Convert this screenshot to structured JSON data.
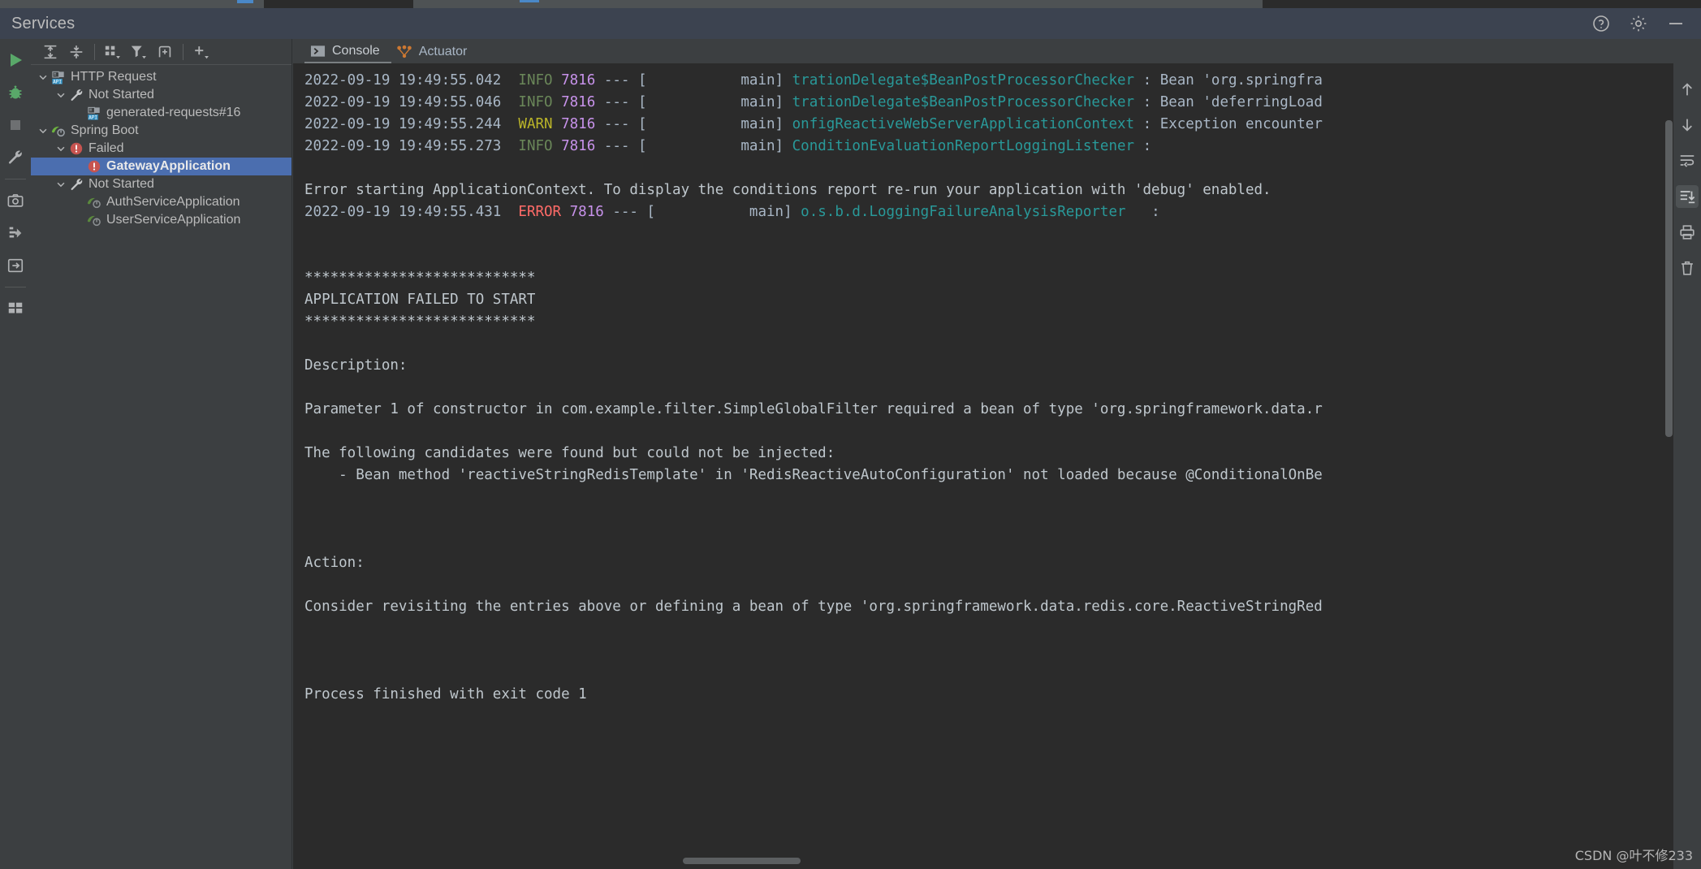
{
  "window": {
    "title": "Services",
    "actions": [
      {
        "name": "help-icon",
        "label": "?"
      },
      {
        "name": "settings-gear-icon",
        "label": "Settings"
      },
      {
        "name": "minimize-icon",
        "label": "Minimize"
      }
    ]
  },
  "left_strip": {
    "items": [
      {
        "name": "run-icon",
        "label": "Run"
      },
      {
        "name": "debug-icon",
        "label": "Debug"
      },
      {
        "name": "stop-icon",
        "label": "Stop"
      },
      {
        "name": "settings-wrench-icon",
        "label": "Configure"
      },
      {
        "name": "camera-icon",
        "label": "Snapshot"
      },
      {
        "name": "profiler-icon",
        "label": "Profiler"
      },
      {
        "name": "open-in-icon",
        "label": "Open"
      },
      {
        "name": "dashboard-icon",
        "label": "Dashboard"
      }
    ]
  },
  "tree_toolbar": {
    "items": [
      {
        "name": "expand-all-icon",
        "label": "Expand All"
      },
      {
        "name": "collapse-all-icon",
        "label": "Collapse All"
      },
      {
        "name": "group-by-icon",
        "label": "Group By"
      },
      {
        "name": "filter-icon",
        "label": "Filter"
      },
      {
        "name": "add-tab-icon",
        "label": "Add Tab"
      },
      {
        "name": "add-service-icon",
        "label": "Add Service"
      }
    ]
  },
  "tree": {
    "nodes": [
      {
        "label": "HTTP Request",
        "indent": 0,
        "icon": "api-icon",
        "expanded": true,
        "selected": false
      },
      {
        "label": "Not Started",
        "indent": 1,
        "icon": "wrench-icon",
        "expanded": true,
        "selected": false
      },
      {
        "label": "generated-requests#16",
        "indent": 2,
        "icon": "api-icon",
        "expanded": null,
        "selected": false
      },
      {
        "label": "Spring Boot",
        "indent": 0,
        "icon": "spring-icon",
        "expanded": true,
        "selected": false
      },
      {
        "label": "Failed",
        "indent": 1,
        "icon": "error-icon",
        "expanded": true,
        "selected": false
      },
      {
        "label": "GatewayApplication",
        "indent": 2,
        "icon": "error-icon",
        "expanded": null,
        "selected": true
      },
      {
        "label": "Not Started",
        "indent": 1,
        "icon": "wrench-icon",
        "expanded": true,
        "selected": false
      },
      {
        "label": "AuthServiceApplication",
        "indent": 2,
        "icon": "spring-gray-icon",
        "expanded": null,
        "selected": false
      },
      {
        "label": "UserServiceApplication",
        "indent": 2,
        "icon": "spring-gray-icon",
        "expanded": null,
        "selected": false
      }
    ]
  },
  "tabs": [
    {
      "name": "tab-console",
      "label": "Console",
      "icon": "console-icon",
      "active": true
    },
    {
      "name": "tab-actuator",
      "label": "Actuator",
      "icon": "actuator-icon",
      "active": false
    }
  ],
  "console": {
    "lines": [
      {
        "type": "log",
        "ts": "2022-09-19 19:49:55.042",
        "level": "INFO",
        "pid": "7816",
        "dash": "---",
        "thread": "[           main]",
        "logger": "trationDelegate$BeanPostProcessorChecker",
        "sep": " : ",
        "msg": "Bean 'org.springfra"
      },
      {
        "type": "log",
        "ts": "2022-09-19 19:49:55.046",
        "level": "INFO",
        "pid": "7816",
        "dash": "---",
        "thread": "[           main]",
        "logger": "trationDelegate$BeanPostProcessorChecker",
        "sep": " : ",
        "msg": "Bean 'deferringLoad"
      },
      {
        "type": "log",
        "ts": "2022-09-19 19:49:55.244",
        "level": "WARN",
        "pid": "7816",
        "dash": "---",
        "thread": "[           main]",
        "logger": "onfigReactiveWebServerApplicationContext",
        "sep": " : ",
        "msg": "Exception encounter"
      },
      {
        "type": "log",
        "ts": "2022-09-19 19:49:55.273",
        "level": "INFO",
        "pid": "7816",
        "dash": "---",
        "thread": "[           main]",
        "logger": "ConditionEvaluationReportLoggingListener",
        "sep": " : ",
        "msg": ""
      },
      {
        "type": "blank"
      },
      {
        "type": "plain",
        "text": "Error starting ApplicationContext. To display the conditions report re-run your application with 'debug' enabled."
      },
      {
        "type": "log",
        "ts": "2022-09-19 19:49:55.431",
        "level": "ERROR",
        "pid": "7816",
        "dash": "---",
        "thread": "[           main]",
        "logger": "o.s.b.d.LoggingFailureAnalysisReporter",
        "sep": "   : ",
        "msg": ""
      },
      {
        "type": "blank"
      },
      {
        "type": "blank"
      },
      {
        "type": "plain",
        "text": "***************************"
      },
      {
        "type": "plain",
        "text": "APPLICATION FAILED TO START"
      },
      {
        "type": "plain",
        "text": "***************************"
      },
      {
        "type": "blank"
      },
      {
        "type": "plain",
        "text": "Description:"
      },
      {
        "type": "blank"
      },
      {
        "type": "plain",
        "text": "Parameter 1 of constructor in com.example.filter.SimpleGlobalFilter required a bean of type 'org.springframework.data.r"
      },
      {
        "type": "blank"
      },
      {
        "type": "plain",
        "text": "The following candidates were found but could not be injected:"
      },
      {
        "type": "plain",
        "text": "    - Bean method 'reactiveStringRedisTemplate' in 'RedisReactiveAutoConfiguration' not loaded because @ConditionalOnBe"
      },
      {
        "type": "blank"
      },
      {
        "type": "blank"
      },
      {
        "type": "blank"
      },
      {
        "type": "plain",
        "text": "Action:"
      },
      {
        "type": "blank"
      },
      {
        "type": "plain",
        "text": "Consider revisiting the entries above or defining a bean of type 'org.springframework.data.redis.core.ReactiveStringRed"
      },
      {
        "type": "blank"
      },
      {
        "type": "blank"
      },
      {
        "type": "blank"
      },
      {
        "type": "plain",
        "text": "Process finished with exit code 1"
      }
    ]
  },
  "gutter": {
    "items": [
      {
        "name": "scroll-up-icon",
        "label": "Up",
        "active": false
      },
      {
        "name": "scroll-down-icon",
        "label": "Down",
        "active": false
      },
      {
        "name": "soft-wrap-icon",
        "label": "Soft-Wrap",
        "active": false
      },
      {
        "name": "scroll-to-end-icon",
        "label": "Scroll to End",
        "active": true
      },
      {
        "name": "print-icon",
        "label": "Print",
        "active": false
      },
      {
        "name": "trash-icon",
        "label": "Clear All",
        "active": false
      }
    ]
  },
  "watermark": {
    "text": "CSDN @叶不修233"
  }
}
